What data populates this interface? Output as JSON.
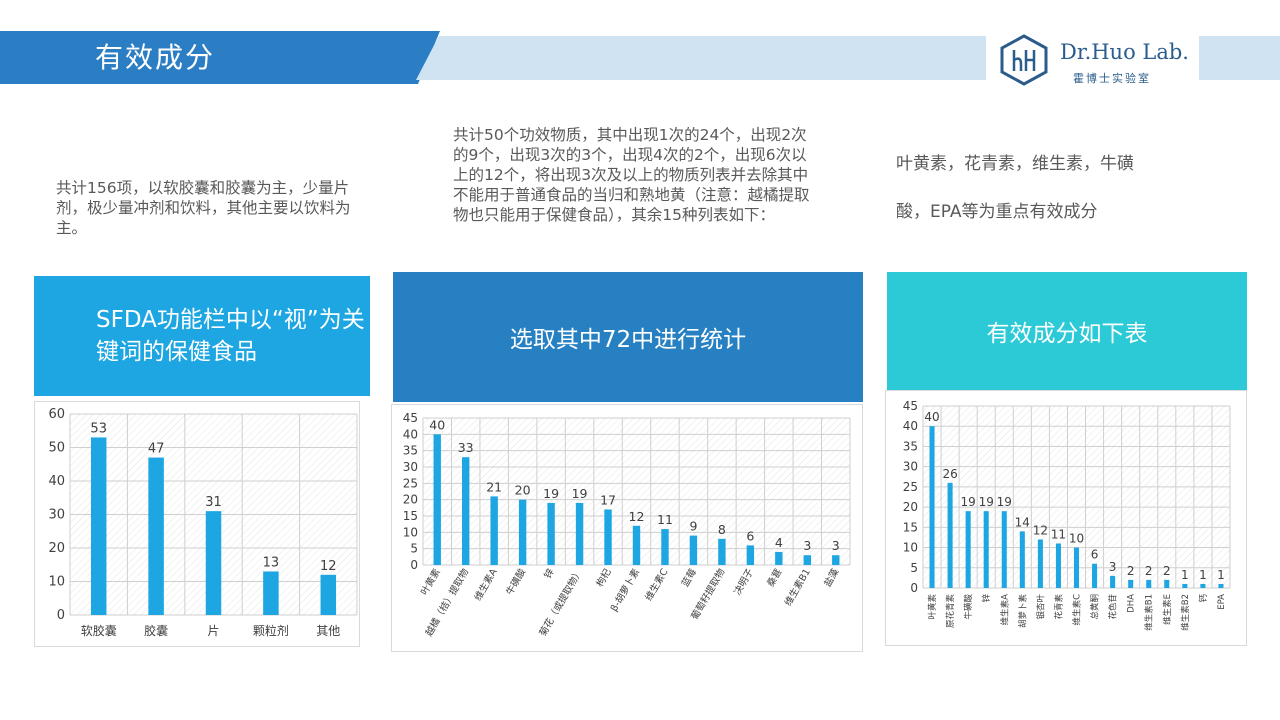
{
  "header": {
    "title": "有效成分"
  },
  "logo": {
    "brand": "Dr.Huo Lab.",
    "sub": "霍博士实验室"
  },
  "descriptions": {
    "left": "共计156项，以软胶囊和胶囊为主，少量片剂，极少量冲剂和饮料，其他主要以饮料为主。",
    "middle": "共计50个功效物质，其中出现1次的24个，出现2次的9个，出现3次的3个，出现4次的2个，出现6次以上的12个，将出现3次及以上的物质列表并去除其中不能用于普通食品的当归和熟地黄（注意：越橘提取物也只能用于保健食品），其余15种列表如下：",
    "right_line1": "叶黄素，花青素，维生素，牛磺",
    "right_line2": "酸，EPA等为重点有效成分"
  },
  "panels": {
    "left_title": "SFDA功能栏中以“视”为关键词的保健食品",
    "middle_title": "选取其中72中进行统计",
    "right_title": "有效成分如下表"
  },
  "colors": {
    "bar": "#1da6e2",
    "header_dark": "#2b7dc4",
    "header_light": "#cfe3f3",
    "panel_left": "#1da6e2",
    "panel_mid": "#2680c2",
    "panel_right": "#2ccad7"
  },
  "chart_data": [
    {
      "type": "bar",
      "categories": [
        "软胶囊",
        "胶囊",
        "片",
        "颗粒剂",
        "其他"
      ],
      "values": [
        53,
        47,
        31,
        13,
        12
      ],
      "ylim": [
        0,
        60
      ],
      "yticks": [
        0,
        10,
        20,
        30,
        40,
        50,
        60
      ],
      "data_labels": true,
      "grid": true
    },
    {
      "type": "bar",
      "categories": [
        "叶黄素",
        "越橘（桔）提取物",
        "维生素A",
        "牛磺酸",
        "锌",
        "菊花（或提取物）",
        "枸杞",
        "β-胡萝卜素",
        "维生素C",
        "蓝莓",
        "葡萄籽提取物",
        "决明子",
        "桑葚",
        "维生素B1",
        "盐藻"
      ],
      "values": [
        40,
        33,
        21,
        20,
        19,
        19,
        17,
        12,
        11,
        9,
        8,
        6,
        4,
        3,
        3
      ],
      "ylim": [
        0,
        45
      ],
      "yticks": [
        0,
        5,
        10,
        15,
        20,
        25,
        30,
        35,
        40,
        45
      ],
      "data_labels": true,
      "grid": true
    },
    {
      "type": "bar",
      "categories": [
        "叶黄素",
        "原花青素",
        "牛磺酸",
        "锌",
        "维生素A",
        "胡萝卜素",
        "银杏叶",
        "花青素",
        "维生素C",
        "总黄酮",
        "花色苷",
        "DHA",
        "维生素B1",
        "维生素E",
        "维生素B2",
        "钙",
        "EPA"
      ],
      "values": [
        40,
        26,
        19,
        19,
        19,
        14,
        12,
        11,
        10,
        6,
        3,
        2,
        2,
        2,
        1,
        1,
        1
      ],
      "ylim": [
        0,
        45
      ],
      "yticks": [
        0,
        5,
        10,
        15,
        20,
        25,
        30,
        35,
        40,
        45
      ],
      "data_labels": true,
      "grid": true
    }
  ]
}
